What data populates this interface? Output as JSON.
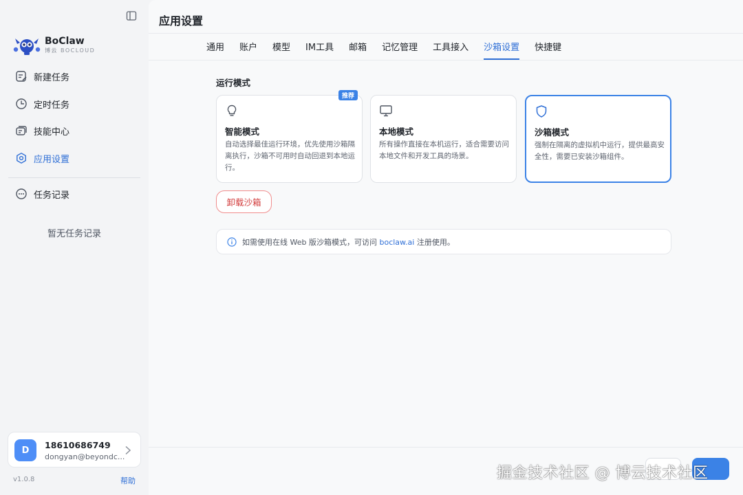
{
  "app": {
    "page_title": "应用设置"
  },
  "brand": {
    "name": "BoClaw",
    "subtitle": "博云 BOCLOUD"
  },
  "sidebar": {
    "items": [
      {
        "label": "新建任务",
        "icon": "edit-icon"
      },
      {
        "label": "定时任务",
        "icon": "clock-icon"
      },
      {
        "label": "技能中心",
        "icon": "skills-icon"
      },
      {
        "label": "应用设置",
        "icon": "settings-icon",
        "active": true
      }
    ],
    "records": {
      "label": "任务记录",
      "icon": "chat-icon"
    },
    "empty_records": "暂无任务记录",
    "version": "v1.0.8",
    "help": "帮助"
  },
  "user": {
    "initial": "D",
    "phone": "18610686749",
    "email": "dongyan@beyondc..."
  },
  "tabs": [
    {
      "label": "通用"
    },
    {
      "label": "账户"
    },
    {
      "label": "模型"
    },
    {
      "label": "IM工具"
    },
    {
      "label": "邮箱"
    },
    {
      "label": "记忆管理"
    },
    {
      "label": "工具接入"
    },
    {
      "label": "沙箱设置",
      "active": true
    },
    {
      "label": "快捷键"
    }
  ],
  "sandbox": {
    "section_label": "运行模式",
    "modes": [
      {
        "title": "智能模式",
        "description": "自动选择最佳运行环境，优先使用沙箱隔离执行，沙箱不可用时自动回退到本地运行。",
        "badge": "推荐",
        "icon": "lightbulb-icon"
      },
      {
        "title": "本地模式",
        "description": "所有操作直接在本机运行，适合需要访问本地文件和开发工具的场景。",
        "icon": "monitor-icon"
      },
      {
        "title": "沙箱模式",
        "description": "强制在隔离的虚拟机中运行，提供最高安全性，需要已安装沙箱组件。",
        "icon": "shield-icon",
        "selected": true
      }
    ],
    "uninstall_label": "卸载沙箱",
    "info": {
      "prefix": "如需使用在线 Web 版沙箱模式，可访问 ",
      "link": "boclaw.ai",
      "suffix": " 注册使用。"
    }
  },
  "watermark": "掘金技术社区 @ 博云技术社区",
  "colors": {
    "accent": "#3b82e6",
    "danger": "#d23b3b",
    "avatar": "#4e8ef7"
  }
}
